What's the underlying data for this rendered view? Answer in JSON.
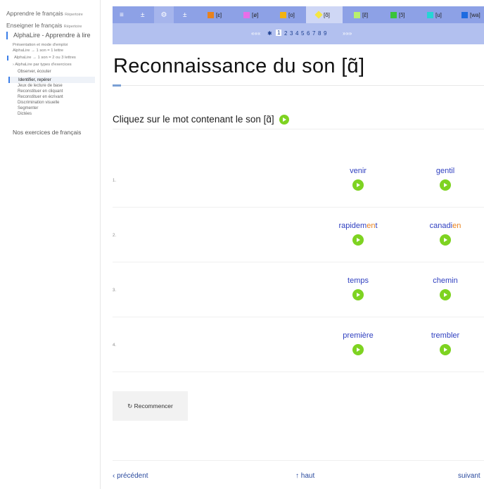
{
  "sidebar": {
    "top": [
      {
        "label": "Apprendre le français",
        "tag": "Répertoire"
      },
      {
        "label": "Enseigner le français",
        "tag": "Répertoire"
      }
    ],
    "section": "AlphaLire - Apprendre à lire",
    "links": [
      "Présentation et mode d'emploi",
      "AlphaLire → 1 son = 1 lettre",
      "AlphaLire → 1 son = 2 ou 3 lettres",
      "› AlphaLire par types d'exercices"
    ],
    "subitems": [
      "Observer, écouter",
      "Identifier, repérer",
      "Jeux de lecture de base",
      "Reconstituer en cliquant",
      "Reconstituer en écrivant",
      "Discrimination visuelle",
      "Segmenter",
      "Dictées"
    ],
    "bottom": "Nos exercices de français"
  },
  "topbar": {
    "icons": [
      "≡",
      "±",
      "⚙",
      "±"
    ],
    "sounds": [
      {
        "label": "[ɛ]",
        "color": "#e8821e"
      },
      {
        "label": "[ø]",
        "color": "#e86ee8"
      },
      {
        "label": "[o]",
        "color": "#f2b311"
      },
      {
        "label": "[õ]",
        "color": "#f5e642",
        "active": true
      },
      {
        "label": "[ɛ̃]",
        "color": "#b8f06e"
      },
      {
        "label": "[ɔ̃]",
        "color": "#3ac43a"
      },
      {
        "label": "[u]",
        "color": "#25d5d5"
      },
      {
        "label": "[wa]",
        "color": "#1e6be0"
      }
    ]
  },
  "pager": {
    "prev": "«««",
    "star": "✱",
    "pages": [
      "1",
      "2",
      "3",
      "4",
      "5",
      "6",
      "7",
      "8",
      "9"
    ],
    "current": "1",
    "next": "»»»"
  },
  "main": {
    "title": "Reconnaissance du son [ɑ̃]",
    "instruction": "Cliquez sur le mot contenant le son [ɑ̃]",
    "rows": [
      {
        "num": "1.",
        "left": [
          {
            "t": "venir",
            "h": false
          }
        ],
        "right": [
          {
            "t": "gentil",
            "h": false
          }
        ]
      },
      {
        "num": "2.",
        "left": [
          {
            "t": "rapidem",
            "h": false
          },
          {
            "t": "en",
            "h": true
          },
          {
            "t": "t",
            "h": false
          }
        ],
        "right": [
          {
            "t": "canadi",
            "h": false
          },
          {
            "t": "en",
            "h": true
          }
        ]
      },
      {
        "num": "3.",
        "left": [
          {
            "t": "temps",
            "h": false
          }
        ],
        "right": [
          {
            "t": "chemin",
            "h": false
          }
        ]
      },
      {
        "num": "4.",
        "left": [
          {
            "t": "première",
            "h": false
          }
        ],
        "right": [
          {
            "t": "trembler",
            "h": false
          }
        ]
      }
    ],
    "restart": "↻  Recommencer"
  },
  "footer": {
    "prev": "‹ précédent",
    "top": "↑ haut",
    "next": "suivant"
  }
}
